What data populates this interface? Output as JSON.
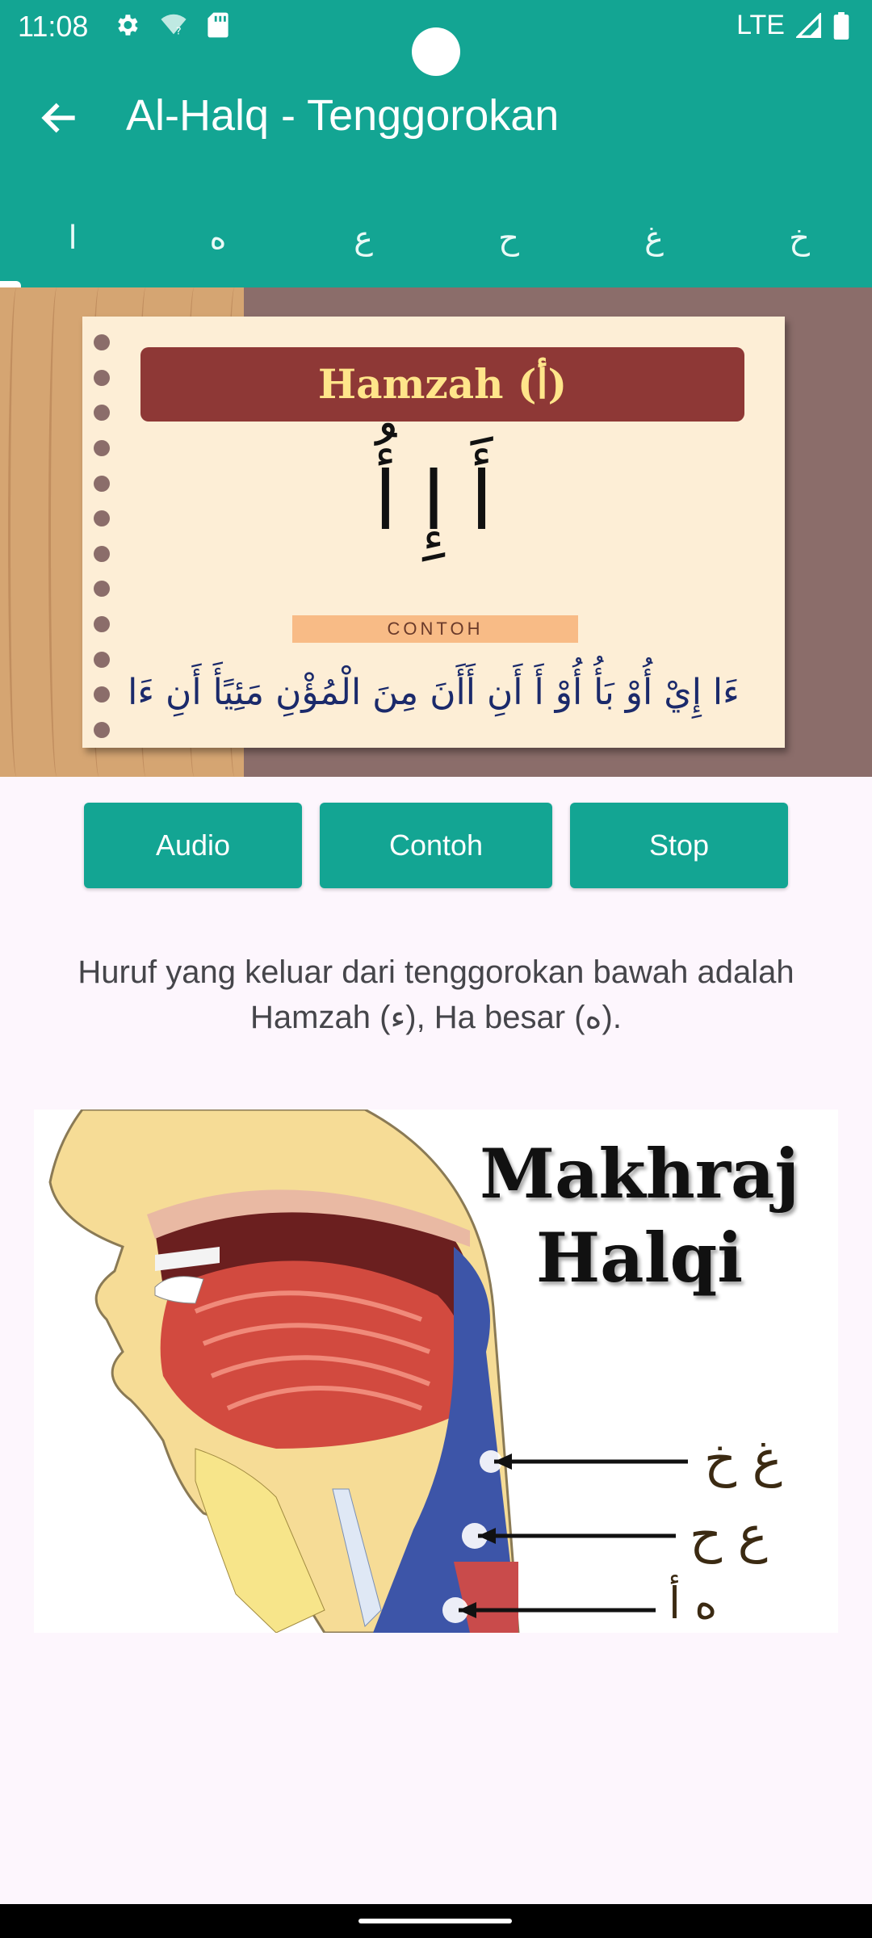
{
  "status": {
    "time": "11:08",
    "network": "LTE"
  },
  "appbar": {
    "title": "Al-Halq - Tenggorokan"
  },
  "tabs": [
    "ا",
    "ه",
    "ع",
    "ح",
    "غ",
    "خ"
  ],
  "card": {
    "heading": "Hamzah (أ)",
    "letters": "أَ إِ أُ",
    "example_label": "CONTOH",
    "example_text": "ءَا إِيْ أُوْ بَأُ أُوْ أَ أَنِ أَأَنَ مِنَ الْمُؤْنِ مَئِيًأَ أَنِ ءَا"
  },
  "buttons": {
    "audio": "Audio",
    "contoh": "Contoh",
    "stop": "Stop"
  },
  "description": "Huruf yang keluar dari tenggorokan bawah adalah Hamzah (ء), Ha besar (ه).",
  "diagram": {
    "title_line1": "Makhraj",
    "title_line2": "Halqi",
    "row1": "غ خ",
    "row2": "ع ح",
    "row3": "ه أ"
  },
  "colors": {
    "primary": "#13a593",
    "banner": "#8e3836",
    "paper": "#fdeed6",
    "background": "#fdf6fd"
  },
  "icons": {
    "back": "arrow-left-icon",
    "settings": "gear-icon",
    "wifi": "wifi-question-icon",
    "sd": "sd-card-icon",
    "signal": "signal-icon",
    "battery": "battery-icon"
  }
}
